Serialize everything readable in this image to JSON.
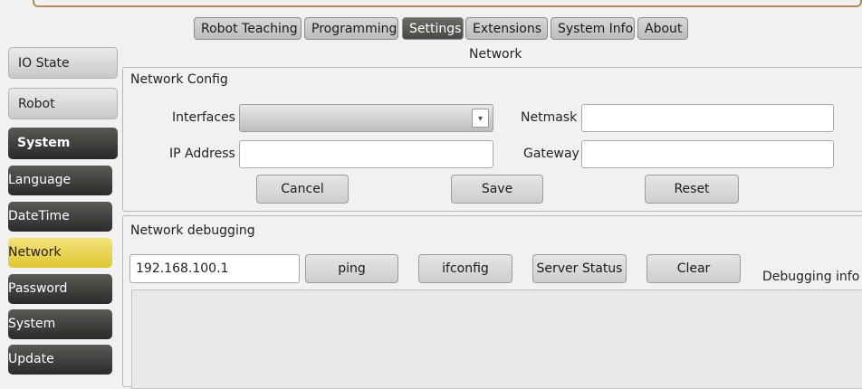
{
  "tabs": [
    "Robot Teaching",
    "Programming",
    "Settings",
    "Extensions",
    "System Info",
    "About"
  ],
  "page_title": "Network",
  "sidebar": {
    "items": [
      "IO State",
      "Robot",
      "System"
    ],
    "sub_items": [
      "Language",
      "DateTime",
      "Network",
      "Password",
      "System",
      "Update"
    ]
  },
  "network_config": {
    "title": "Network Config",
    "interfaces_label": "Interfaces",
    "interfaces_value": "",
    "ip_label": "IP Address",
    "ip_value": "",
    "netmask_label": "Netmask",
    "netmask_value": "",
    "gateway_label": "Gateway",
    "gateway_value": "",
    "cancel_label": "Cancel",
    "save_label": "Save",
    "reset_label": "Reset"
  },
  "debugging": {
    "title": "Network debugging",
    "address_value": "192.168.100.1",
    "ping_label": "ping",
    "ifconfig_label": "ifconfig",
    "server_status_label": "Server Status",
    "clear_label": "Clear",
    "info_label": "Debugging info",
    "output": ""
  },
  "icons": {
    "combo_arrow": "triangle-down-icon"
  },
  "colors": {
    "active_sub": "#e7d04a",
    "active_tab": "#5a5956",
    "dark_button": "#3a3937"
  }
}
